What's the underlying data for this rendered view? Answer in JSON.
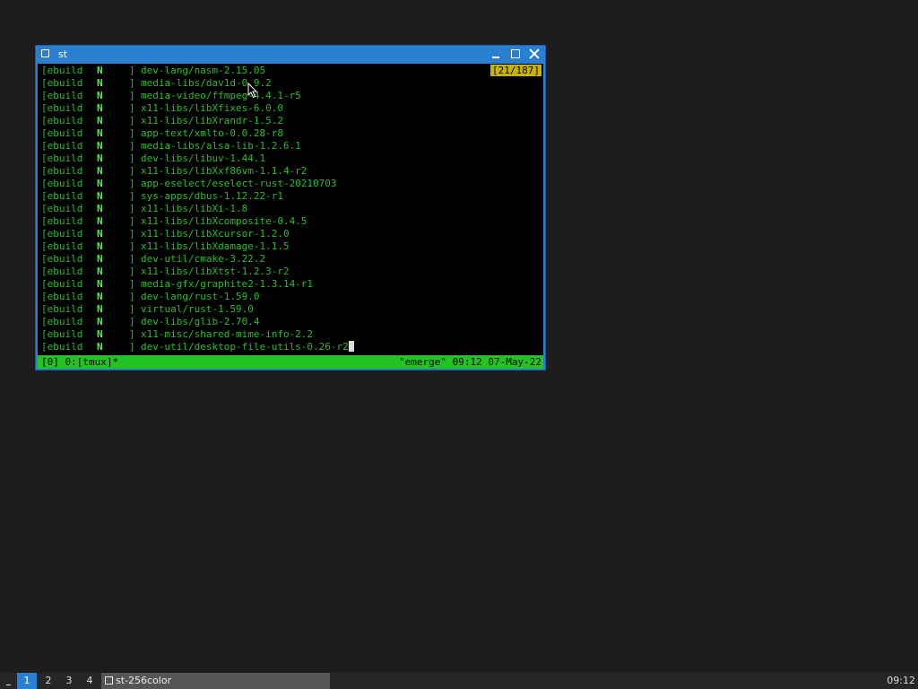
{
  "window": {
    "title": "st"
  },
  "terminal": {
    "counter": "[21/187]",
    "status_left": "[0] 0:[tmux]*",
    "status_right": "\"emerge\" 09:12 07-May-22",
    "tag_open": "[ebuild",
    "tag_flag": "N",
    "tag_close": "]",
    "packages": [
      "dev-lang/nasm-2.15.05",
      "media-libs/dav1d-0.9.2",
      "media-video/ffmpeg-4.4.1-r5",
      "x11-libs/libXfixes-6.0.0",
      "x11-libs/libXrandr-1.5.2",
      "app-text/xmlto-0.0.28-r8",
      "media-libs/alsa-lib-1.2.6.1",
      "dev-libs/libuv-1.44.1",
      "x11-libs/libXxf86vm-1.1.4-r2",
      "app-eselect/eselect-rust-20210703",
      "sys-apps/dbus-1.12.22-r1",
      "x11-libs/libXi-1.8",
      "x11-libs/libXcomposite-0.4.5",
      "x11-libs/libXcursor-1.2.0",
      "x11-libs/libXdamage-1.1.5",
      "dev-util/cmake-3.22.2",
      "x11-libs/libXtst-1.2.3-r2",
      "media-gfx/graphite2-1.3.14-r1",
      "dev-lang/rust-1.59.0",
      "virtual/rust-1.59.0",
      "dev-libs/glib-2.70.4",
      "x11-misc/shared-mime-info-2.2",
      "dev-util/desktop-file-utils-0.26-r2"
    ]
  },
  "taskbar": {
    "workspaces": [
      "1",
      "2",
      "3",
      "4"
    ],
    "active_workspace": "1",
    "task_label": "st-256color",
    "clock": "09:12"
  },
  "colors": {
    "accent": "#2a7fd0",
    "terminal_text": "#2dbb2d",
    "status_bar": "#22c322",
    "counter_bg": "#c8b400"
  }
}
